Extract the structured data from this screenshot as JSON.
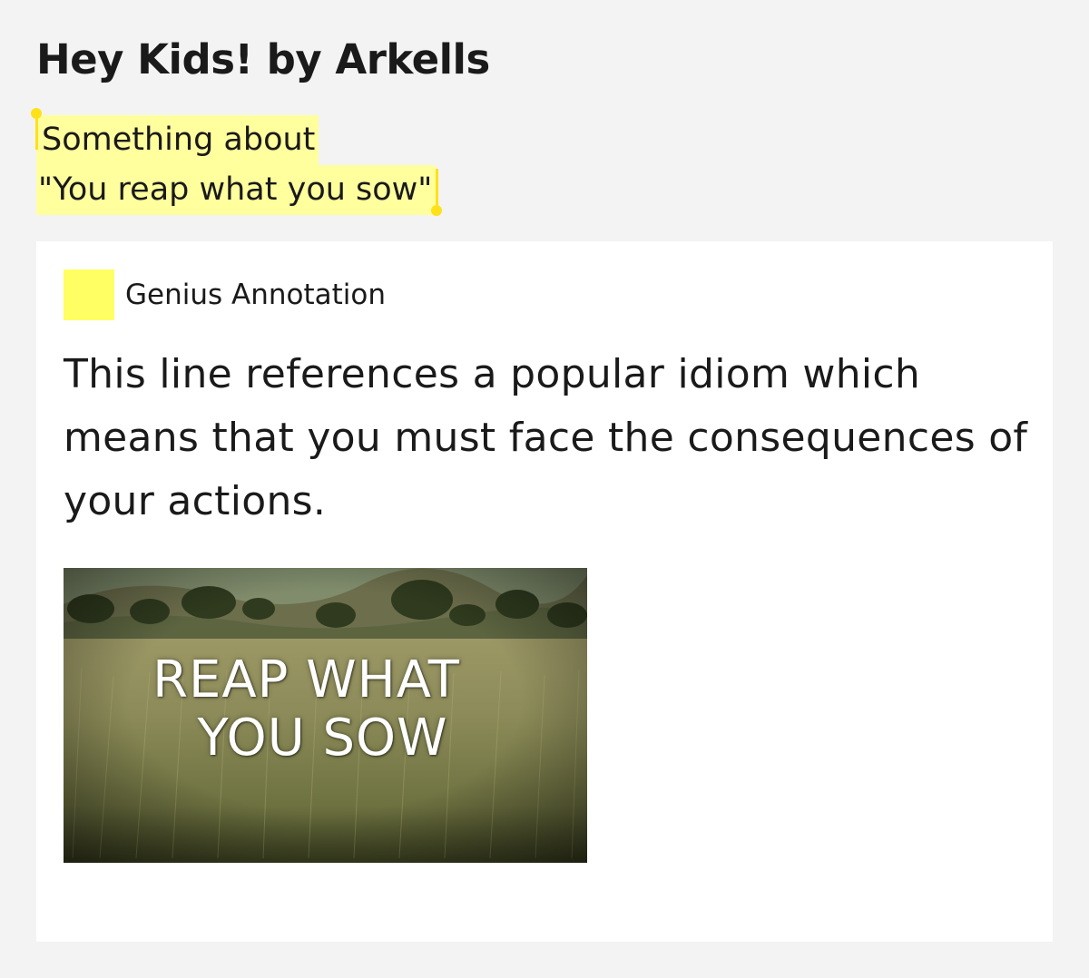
{
  "page": {
    "title": "Hey Kids! by Arkells"
  },
  "lyric": {
    "line1": "Something about",
    "line2": "\"You reap what you sow\""
  },
  "annotation": {
    "label": "Genius Annotation",
    "body": "This line references a popular idiom which means that you must face the consequences of your actions.",
    "image": {
      "line1": "REAP WHAT",
      "line2": "YOU SOW"
    }
  },
  "colors": {
    "background": "#f3f3f3",
    "highlight": "#ffff9e",
    "marker": "#ffe119",
    "swatch": "#ffff64",
    "card": "#ffffff"
  }
}
